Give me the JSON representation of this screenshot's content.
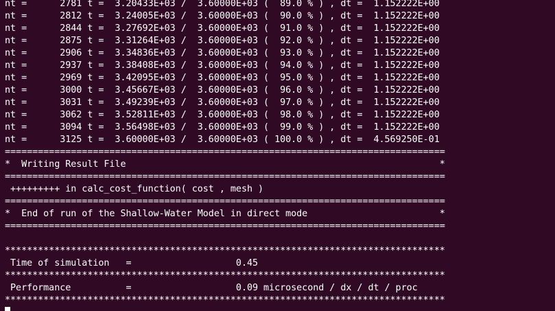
{
  "terminal": {
    "lines": [
      "nt =      2781 t =  3.20433E+03 /  3.60000E+03 (  89.0 % ) , dt =  1.152222E+00",
      "nt =      2812 t =  3.24005E+03 /  3.60000E+03 (  90.0 % ) , dt =  1.152222E+00",
      "nt =      2844 t =  3.27692E+03 /  3.60000E+03 (  91.0 % ) , dt =  1.152222E+00",
      "nt =      2875 t =  3.31264E+03 /  3.60000E+03 (  92.0 % ) , dt =  1.152222E+00",
      "nt =      2906 t =  3.34836E+03 /  3.60000E+03 (  93.0 % ) , dt =  1.152222E+00",
      "nt =      2937 t =  3.38408E+03 /  3.60000E+03 (  94.0 % ) , dt =  1.152222E+00",
      "nt =      2969 t =  3.42095E+03 /  3.60000E+03 (  95.0 % ) , dt =  1.152222E+00",
      "nt =      3000 t =  3.45667E+03 /  3.60000E+03 (  96.0 % ) , dt =  1.152222E+00",
      "nt =      3031 t =  3.49239E+03 /  3.60000E+03 (  97.0 % ) , dt =  1.152222E+00",
      "nt =      3062 t =  3.52811E+03 /  3.60000E+03 (  98.0 % ) , dt =  1.152222E+00",
      "nt =      3094 t =  3.56498E+03 /  3.60000E+03 (  99.0 % ) , dt =  1.152222E+00",
      "nt =      3125 t =  3.60000E+03 /  3.60000E+03 ( 100.0 % ) , dt =  4.569250E-01",
      "================================================================================",
      "*  Writing Result File                                                         *",
      "================================================================================",
      " +++++++++ in calc_cost_function( cost , mesh )",
      "================================================================================",
      "*  End of run of the Shallow-Water Model in direct mode                        *",
      "================================================================================",
      "",
      "********************************************************************************",
      " Time of simulation   =                   0.45",
      "********************************************************************************",
      " Performance          =                   0.09 microsecond / dx / dt / proc",
      "********************************************************************************"
    ]
  }
}
